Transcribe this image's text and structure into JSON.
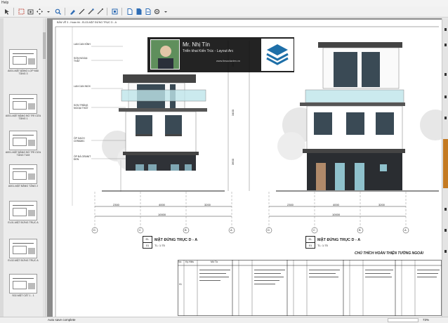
{
  "menubar": {
    "help": "Help"
  },
  "sidebar": {
    "thumbnails": [
      {
        "label": "A001-MẶT BẰNG LỢP MÁI TẦNG 3"
      },
      {
        "label": "A001-MẶT BẰNG BỐ TRÍ CỬA TẦNG 1"
      },
      {
        "label": "A001-MẶT BẰNG BỐ TRÍ CỬA TẦNG TUM"
      },
      {
        "label": "A001-MẶT BẰNG TẦNG 2"
      },
      {
        "label": "EL01-MẶT ĐỨNG TRỤC A"
      },
      {
        "label": "EL02-MẶT ĐỨNG TRỤC A"
      },
      {
        "label": "S02-MẶT CẮT 1 - 1"
      }
    ]
  },
  "document": {
    "sheet_title": "BẢN VẼ 3 - Hoàn thi - EL03-MẶT ĐỨNG TRỤC D - A",
    "overlay": {
      "name": "Mr. Nhị Tín",
      "subtitle": "Triển khai Kiến Trúc - Layout Arc",
      "url": "www.tinsoclavien.vn"
    },
    "drawing": {
      "left_labels": [
        "LAN CAN KÍNH",
        "SƠN NGOẠI THẤT",
        "LAN CAN INOX",
        "SƠN TRẮNG NGOẠI THẤT",
        "ỐP GẠCH CERAMIC",
        "ỐP ĐÁ GRANIT ĐEN"
      ],
      "dims_left": [
        "2300",
        "4000",
        "3200"
      ],
      "dims_total_left": "10000",
      "dims_right": [
        "2300",
        "4000",
        "3200"
      ],
      "dims_total_right": "10000",
      "heights": [
        "3400",
        "3400",
        "3600"
      ],
      "axes_left": [
        "D",
        "C",
        "B",
        "A"
      ],
      "axes_right": [
        "D",
        "C",
        "B",
        "A"
      ]
    },
    "views": [
      {
        "code": "EL",
        "sheet": "01",
        "title": "MẶT ĐỨNG TRỤC D - A",
        "scale": "TL: 1:75"
      },
      {
        "code": "EL",
        "sheet": "01",
        "title": "MẶT ĐỨNG TRỤC D - A",
        "scale": "TL: 1:75"
      }
    ],
    "legend": {
      "heading": "CHÚ THÍCH HOÀN THIỆN TƯỜNG NGOÀI",
      "headers": [
        "No",
        "Ký Hiệu",
        "Mô Tả"
      ],
      "row_no": "01"
    }
  },
  "statusbar": {
    "left": "Auto save complete",
    "right": "73%"
  }
}
